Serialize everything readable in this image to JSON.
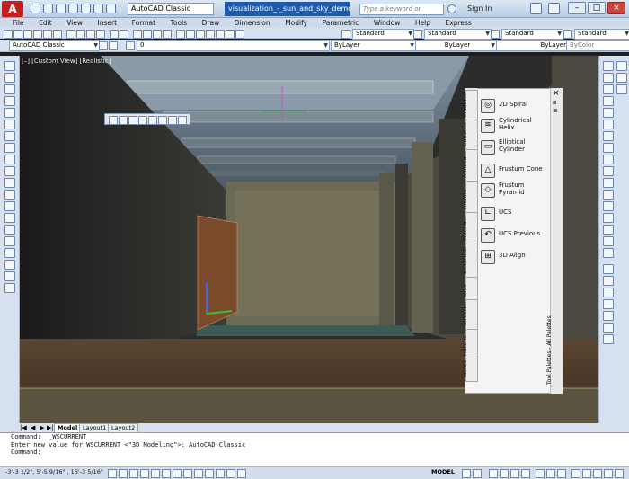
{
  "titlebar": {
    "logo": "A",
    "workspace": "AutoCAD Classic",
    "document": "visualization_-_sun_and_sky_demo0.dwg",
    "search_placeholder": "Type a keyword or phrase",
    "signin": "Sign In",
    "minimize": "–",
    "maximize": "□",
    "close": "×"
  },
  "menubar": {
    "items": [
      "File",
      "Edit",
      "View",
      "Insert",
      "Format",
      "Tools",
      "Draw",
      "Dimension",
      "Modify",
      "Parametric",
      "Window",
      "Help",
      "Express"
    ]
  },
  "toolbar2": {
    "text_style": "Standard",
    "dim_style": "Standard",
    "table_style": "Standard",
    "mleader_style": "Standard"
  },
  "toolbar3": {
    "workspace": "AutoCAD Classic",
    "layer": "0",
    "color": "ByLayer",
    "linetype": "ByLayer",
    "lineweight": "ByLayer",
    "plotstyle": "ByColor"
  },
  "viewport": {
    "label": "[–] [Custom View] [Realistic]"
  },
  "palette": {
    "tabs": [
      "Model...",
      "Constr...",
      "Annota...",
      "Archite...",
      "Mecha...",
      "Electrical",
      "Civil",
      "Structu...",
      "Hatche...",
      "Tables"
    ],
    "items": [
      {
        "icon": "spiral-icon",
        "symbol": "◎",
        "label": "2D Spiral"
      },
      {
        "icon": "helix-icon",
        "symbol": "≋",
        "label": "Cylindrical Helix"
      },
      {
        "icon": "elliptical-cylinder-icon",
        "symbol": "▭",
        "label": "Elliptical Cylinder"
      },
      {
        "icon": "frustum-cone-icon",
        "symbol": "△",
        "label": "Frustum Cone"
      },
      {
        "icon": "frustum-pyramid-icon",
        "symbol": "◇",
        "label": "Frustum Pyramid"
      },
      {
        "icon": "ucs-icon",
        "symbol": "∟",
        "label": "UCS"
      },
      {
        "icon": "ucs-previous-icon",
        "symbol": "↶",
        "label": "UCS Previous"
      },
      {
        "icon": "3d-align-icon",
        "symbol": "⊞",
        "label": "3D Align"
      }
    ],
    "side_title": "Tool Palettes - All Palettes"
  },
  "layout_tabs": [
    "Model",
    "Layout1",
    "Layout2"
  ],
  "command": {
    "lines": [
      "Command:  _WSCURRENT",
      "Enter new value for WSCURRENT <\"3D Modeling\">: AutoCAD Classic",
      "",
      "Command:"
    ]
  },
  "status": {
    "coords": "-3'-3 1/2\",  5'-5 9/16\" , 16'-3 5/16\"",
    "mode": "MODEL"
  }
}
